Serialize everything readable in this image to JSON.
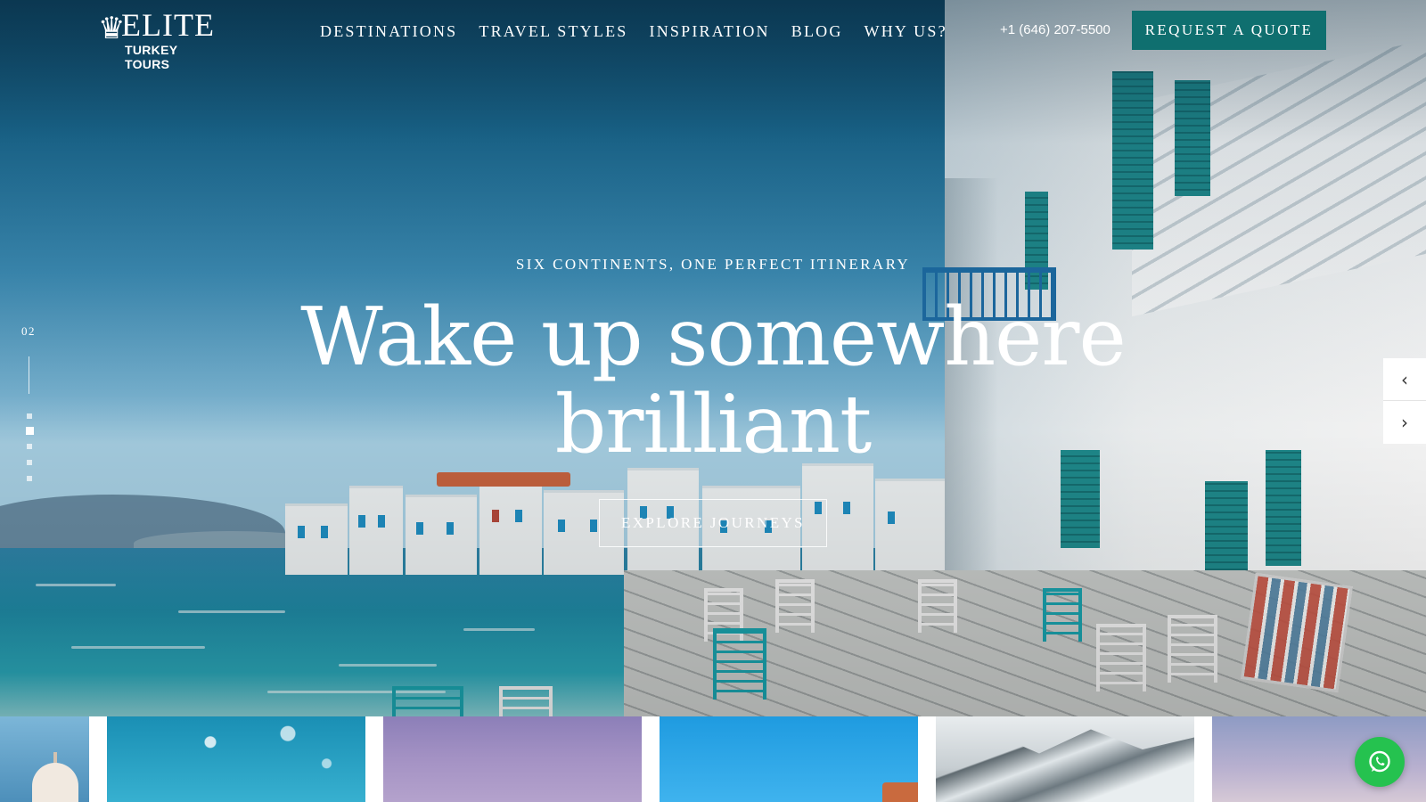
{
  "header": {
    "logo": {
      "brand": "ELITE",
      "subline": "TURKEY TOURS",
      "icon": "tulip-logo-icon"
    },
    "nav": [
      "DESTINATIONS",
      "TRAVEL STYLES",
      "INSPIRATION",
      "BLOG",
      "WHY US?"
    ],
    "phone": "+1 (646) 207-5500",
    "cta_label": "REQUEST A QUOTE"
  },
  "hero": {
    "eyebrow": "SIX CONTINENTS, ONE PERFECT ITINERARY",
    "headline": "Wake up somewhere brilliant",
    "button_label": "EXPLORE JOURNEYS",
    "slide_number": "02",
    "slide_total_dots": 5,
    "active_slide_index": 1,
    "prev_icon": "chevron-left-icon",
    "next_icon": "chevron-right-icon"
  },
  "thumbnails": {
    "count": 6,
    "icons": [
      "dome-thumbnail",
      "sea-sky-thumbnail",
      "purple-dusk-thumbnail",
      "blue-sky-thumbnail",
      "snowy-mountain-thumbnail",
      "cloudy-sky-thumbnail"
    ]
  },
  "chat": {
    "icon": "whatsapp-icon"
  },
  "colors": {
    "cta_background": "#0f6f6f",
    "whatsapp_green": "#25c24f",
    "text_primary": "#ffffff"
  }
}
